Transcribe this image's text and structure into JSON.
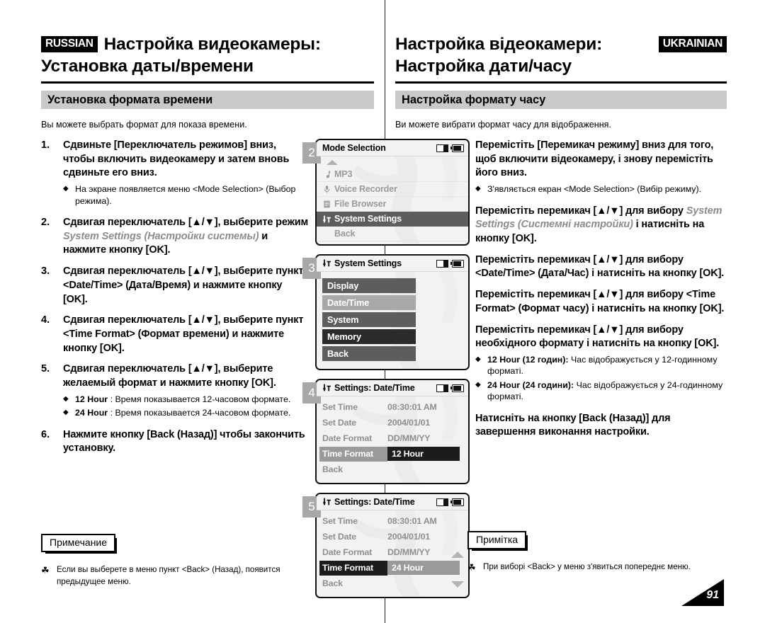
{
  "russian": {
    "lang_tag": "RUSSIAN",
    "title_line1": "Настройка видеокамеры:",
    "title_line2": "Установка даты/времени",
    "section_bar": "Установка формата времени",
    "intro": "Вы можете выбрать формат для показа времени.",
    "steps": [
      {
        "num": "1.",
        "text": "Сдвиньте [Переключатель режимов] вниз, чтобы включить видеокамеру и затем вновь сдвиньте его вниз.",
        "bullets": [
          {
            "mark": "◆",
            "text": "На экране появляется меню <Mode Selection> (Выбор режима)."
          }
        ]
      },
      {
        "num": "2.",
        "text_pre": "Сдвигая переключатель [▲/▼], выберите режим ",
        "text_ital": "System Settings (Настройки системы)",
        "text_post": " и нажмите кнопку [OK].",
        "bullets": []
      },
      {
        "num": "3.",
        "text": "Сдвигая переключатель [▲/▼], выберите пункт <Date/Time> (Дата/Время) и нажмите кнопку [OK].",
        "bullets": []
      },
      {
        "num": "4.",
        "text": "Сдвигая переключатель [▲/▼], выберите пункт <Time Format> (Формат времени) и нажмите кнопку [OK].",
        "bullets": []
      },
      {
        "num": "5.",
        "text": "Сдвигая переключатель [▲/▼], выберите желаемый формат и нажмите кнопку [OK].",
        "bullets": [
          {
            "mark": "◆",
            "bold": "12 Hour",
            "text": " : Время показывается 12-часовом формате."
          },
          {
            "mark": "◆",
            "bold": "24 Hour",
            "text": " : Время показывается 24-часовом формате."
          }
        ]
      },
      {
        "num": "6.",
        "text": "Нажмите кнопку [Back (Назад)] чтобы закончить установку.",
        "bullets": []
      }
    ],
    "note_label": "Примечание",
    "note_mark": "☘",
    "note_text": "Если вы выберете в меню пункт <Back> (Назад), появится предыдущее меню."
  },
  "ukrainian": {
    "lang_tag": "UKRAINIAN",
    "title_line1": "Настройка відеокамери:",
    "title_line2": "Настройка дати/часу",
    "section_bar": "Настройка формату часу",
    "intro": "Ви можете вибрати формат часу для відображення.",
    "steps": [
      {
        "num": "1.",
        "text": "Перемістіть [Перемикач режиму] вниз для того, щоб включити відеокамеру, і знову перемістіть його вниз.",
        "bullets": [
          {
            "mark": "◆",
            "text": "З'являється екран <Mode Selection> (Вибір режиму)."
          }
        ]
      },
      {
        "num": "2.",
        "text_pre": "Перемістіть перемикач [▲/▼] для вибору ",
        "text_ital": "System Settings (Системні настройки)",
        "text_post": " і натисніть на кнопку [OK].",
        "bullets": []
      },
      {
        "num": "3.",
        "text": "Перемістіть перемикач [▲/▼] для вибору <Date/Time> (Дата/Час) і натисніть на кнопку [OK].",
        "bullets": []
      },
      {
        "num": "4.",
        "text": "Перемістіть перемикач [▲/▼] для вибору <Time Format> (Формат часу) і натисніть на кнопку [OK].",
        "bullets": []
      },
      {
        "num": "5.",
        "text": "Перемістіть перемикач [▲/▼] для вибору необхідного формату і натисніть на кнопку [OK].",
        "bullets": [
          {
            "mark": "◆",
            "bold": "12 Hour (12 годин):",
            "text": " Час відображується у 12-годинному форматі."
          },
          {
            "mark": "◆",
            "bold": "24 Hour (24 години):",
            "text": " Час відображується у 24-годинному форматі."
          }
        ]
      },
      {
        "num": "6.",
        "text": "Натисніть на кнопку [Back (Назад)] для завершення виконання настройки.",
        "bullets": []
      }
    ],
    "note_label": "Примітка",
    "note_mark": "☘",
    "note_text": "При виборі <Back> у меню з'явиться попереднє меню."
  },
  "lcd_screens": [
    {
      "step_badge": "2",
      "title": "Mode Selection",
      "icons": [
        "memory-card-icon",
        "battery-icon"
      ],
      "type": "menu",
      "has_up_arrow": true,
      "items": [
        {
          "icon": "music-note-icon",
          "label": "MP3",
          "selected": false
        },
        {
          "icon": "microphone-icon",
          "label": "Voice Recorder",
          "selected": false
        },
        {
          "icon": "document-icon",
          "label": "File Browser",
          "selected": false
        },
        {
          "icon": "settings-icon",
          "label": "System Settings",
          "selected": true
        },
        {
          "icon": "",
          "label": "Back",
          "selected": false
        }
      ]
    },
    {
      "step_badge": "3",
      "title": "System Settings",
      "title_icon": "settings-icon",
      "icons": [
        "memory-card-icon",
        "battery-icon"
      ],
      "type": "buttons",
      "items": [
        {
          "label": "Display",
          "shade": "#5d5d5d"
        },
        {
          "label": "Date/Time",
          "shade": "#a8a8a8"
        },
        {
          "label": "System",
          "shade": "#5d5d5d"
        },
        {
          "label": "Memory",
          "shade": "#2b2b2b"
        },
        {
          "label": "Back",
          "shade": "#5d5d5d"
        }
      ]
    },
    {
      "step_badge": "4",
      "title": "Settings: Date/Time",
      "title_icon": "settings-icon",
      "icons": [
        "memory-card-icon",
        "battery-icon"
      ],
      "type": "keyvalue",
      "scroll_up": false,
      "scroll_down": false,
      "rows": [
        {
          "key": "Set Time",
          "value": "08:30:01 AM",
          "state": "normal"
        },
        {
          "key": "Set Date",
          "value": "2004/01/01",
          "state": "normal"
        },
        {
          "key": "Date Format",
          "value": "DD/MM/YY",
          "state": "normal"
        },
        {
          "key": "Time Format",
          "value": "12 Hour",
          "state": "key-gray-value-dark"
        },
        {
          "key": "Back",
          "value": "",
          "state": "normal"
        }
      ]
    },
    {
      "step_badge": "5",
      "title": "Settings: Date/Time",
      "title_icon": "settings-icon",
      "icons": [
        "memory-card-icon",
        "battery-icon"
      ],
      "type": "keyvalue",
      "scroll_up": true,
      "scroll_down": true,
      "rows": [
        {
          "key": "Set Time",
          "value": "08:30:01 AM",
          "state": "normal"
        },
        {
          "key": "Set Date",
          "value": "2004/01/01",
          "state": "normal"
        },
        {
          "key": "Date Format",
          "value": "DD/MM/YY",
          "state": "normal"
        },
        {
          "key": "Time Format",
          "value": "24 Hour",
          "state": "key-dark-value-gray"
        },
        {
          "key": "Back",
          "value": "",
          "state": "normal"
        }
      ]
    }
  ],
  "page_number": "91",
  "colors": {
    "section_bar_bg": "#c9c9c9",
    "lcd_bg": "#f2f2f2",
    "selected_dark": "#5d5d5d",
    "selected_darker": "#2b2b2b",
    "selected_gray": "#a8a8a8",
    "muted_text": "#9a9a9a",
    "italic_gray": "#8c8c8c"
  }
}
